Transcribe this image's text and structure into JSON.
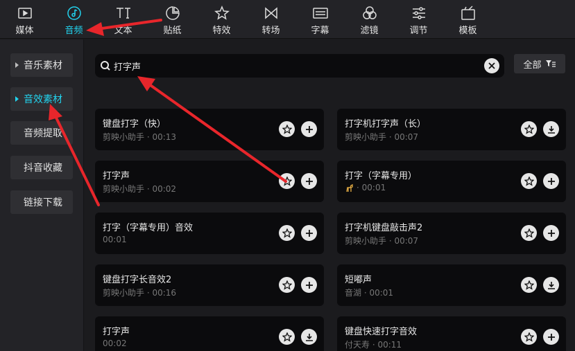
{
  "toolbar": {
    "tabs": [
      {
        "label": "媒体",
        "icon": "media-icon",
        "active": false
      },
      {
        "label": "音频",
        "icon": "audio-icon",
        "active": true
      },
      {
        "label": "文本",
        "icon": "text-icon",
        "active": false
      },
      {
        "label": "贴纸",
        "icon": "sticker-icon",
        "active": false
      },
      {
        "label": "特效",
        "icon": "effects-icon",
        "active": false
      },
      {
        "label": "转场",
        "icon": "transition-icon",
        "active": false
      },
      {
        "label": "字幕",
        "icon": "caption-icon",
        "active": false
      },
      {
        "label": "滤镜",
        "icon": "filter-icon",
        "active": false
      },
      {
        "label": "调节",
        "icon": "adjust-icon",
        "active": false
      },
      {
        "label": "模板",
        "icon": "template-icon",
        "active": false
      }
    ],
    "active_color": "#22d3ee"
  },
  "sidebar": {
    "items": [
      {
        "label": "音乐素材",
        "caret": true,
        "active": false
      },
      {
        "label": "音效素材",
        "caret": true,
        "active": true
      },
      {
        "label": "音频提取",
        "caret": false,
        "active": false
      },
      {
        "label": "抖音收藏",
        "caret": false,
        "active": false
      },
      {
        "label": "链接下载",
        "caret": false,
        "active": false
      }
    ]
  },
  "search": {
    "value": "打字声"
  },
  "filter": {
    "label": "全部"
  },
  "results": [
    {
      "title": "键盘打字（快）",
      "sub": "剪映小助手 · 00:13",
      "action": "add"
    },
    {
      "title": "打字机打字声（长）",
      "sub": "剪映小助手 · 00:07",
      "action": "download"
    },
    {
      "title": "打字声",
      "sub": "剪映小助手 · 00:02",
      "action": "add"
    },
    {
      "title": "打字（字幕专用）",
      "sub": "· 00:01",
      "action": "add",
      "avatar": true
    },
    {
      "title": "打字（字幕专用）音效",
      "sub": "00:01",
      "action": "add"
    },
    {
      "title": "打字机键盘敲击声2",
      "sub": "剪映小助手 · 00:07",
      "action": "add"
    },
    {
      "title": "键盘打字长音效2",
      "sub": "剪映小助手 · 00:16",
      "action": "add"
    },
    {
      "title": "短嘟声",
      "sub": "音湖 · 00:01",
      "action": "download"
    },
    {
      "title": "打字声",
      "sub": "00:02",
      "action": "download"
    },
    {
      "title": "键盘快速打字音效",
      "sub": "付天寿 · 00:11",
      "action": "add"
    }
  ],
  "annotation_color": "#e8262b"
}
